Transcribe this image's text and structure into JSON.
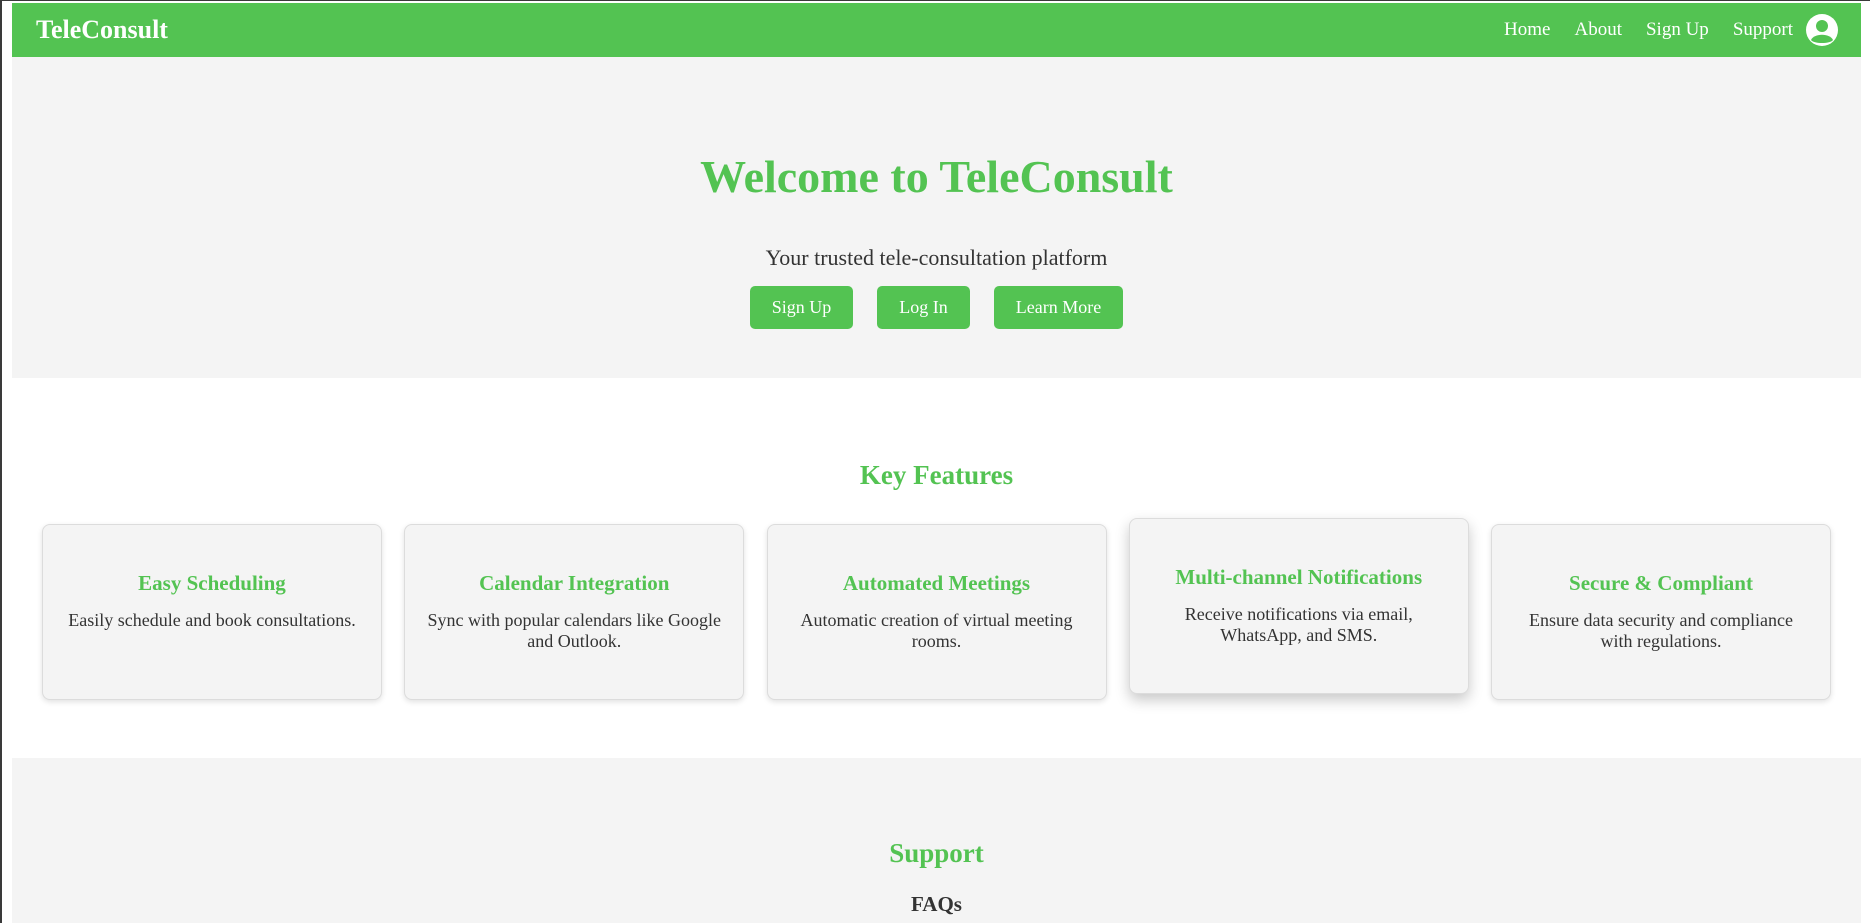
{
  "navbar": {
    "brand": "TeleConsult",
    "links": [
      "Home",
      "About",
      "Sign Up",
      "Support"
    ],
    "user_icon": "user-circle-icon"
  },
  "hero": {
    "title": "Welcome to TeleConsult",
    "subtitle": "Your trusted tele-consultation platform",
    "buttons": [
      "Sign Up",
      "Log In",
      "Learn More"
    ]
  },
  "features": {
    "heading": "Key Features",
    "cards": [
      {
        "title": "Easy Scheduling",
        "text": "Easily schedule and book consultations."
      },
      {
        "title": "Calendar Integration",
        "text": "Sync with popular calendars like Google and Outlook."
      },
      {
        "title": "Automated Meetings",
        "text": "Automatic creation of virtual meeting rooms."
      },
      {
        "title": "Multi-channel Notifications",
        "text": "Receive notifications via email, WhatsApp, and SMS."
      },
      {
        "title": "Secure & Compliant",
        "text": "Ensure data security and compliance with regulations."
      }
    ]
  },
  "support": {
    "heading": "Support",
    "faqs_heading": "FAQs"
  },
  "colors": {
    "brand_green": "#53c352",
    "section_gray": "#f4f4f4",
    "text": "#333333"
  }
}
